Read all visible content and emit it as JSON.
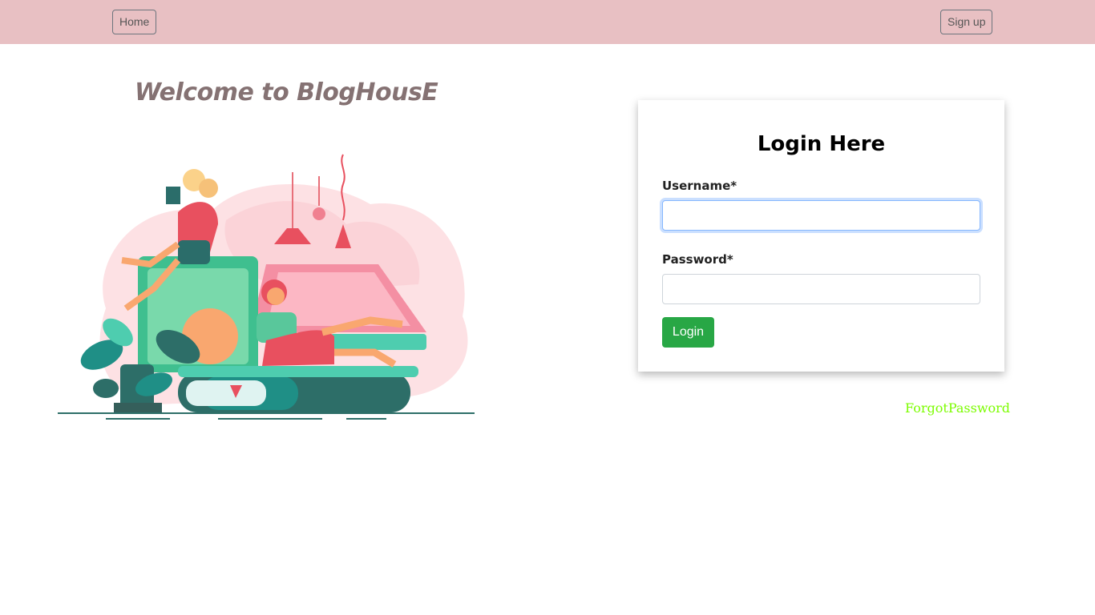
{
  "nav": {
    "home_label": "Home",
    "signup_label": "Sign up"
  },
  "hero": {
    "welcome_text": "Welcome to BlogHousE",
    "illustration_icon": "reading-illustration"
  },
  "login": {
    "title": "Login Here",
    "username_label": "Username*",
    "username_value": "",
    "password_label": "Password*",
    "password_value": "",
    "submit_label": "Login"
  },
  "forgot_link": "ForgotPassword",
  "colors": {
    "navbar": "#e8c0c3",
    "login_button": "#28a745",
    "forgot_link": "#7cfc00",
    "welcome_text": "#857273"
  }
}
